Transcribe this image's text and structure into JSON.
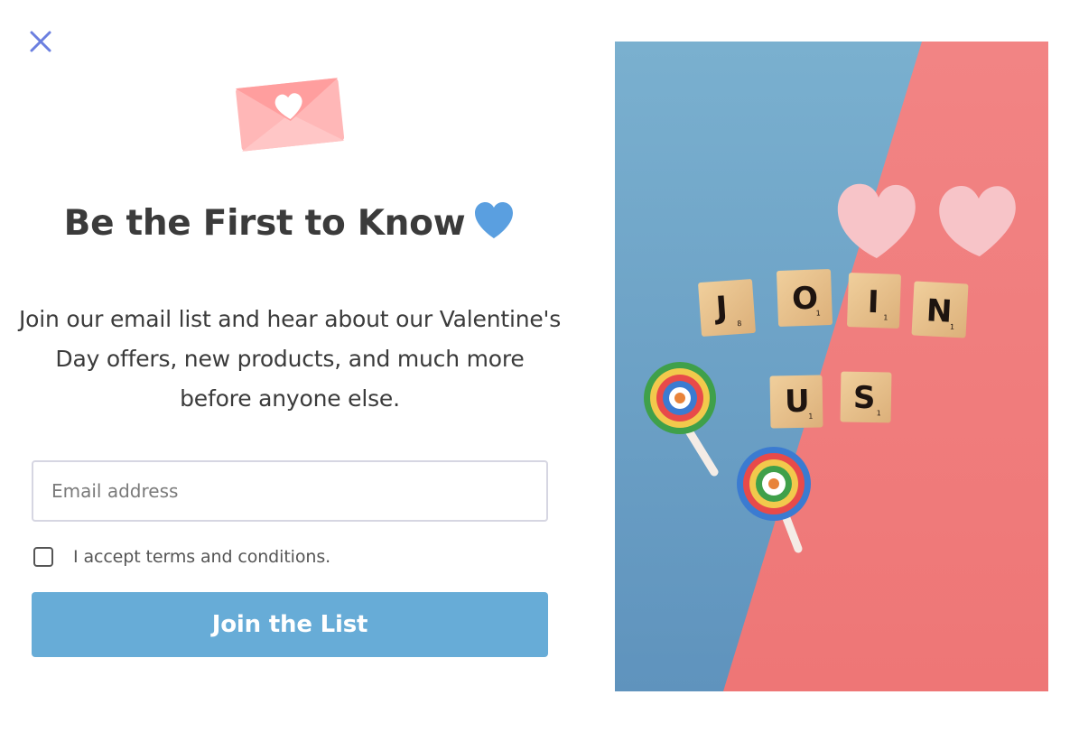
{
  "popup": {
    "title": "Be the First to Know",
    "description": "Join our email list and hear about our Valentine's Day offers, new products, and much more before anyone else.",
    "email_placeholder": "Email address",
    "terms_label": "I accept terms and conditions.",
    "terms_checked": false,
    "submit_label": "Join the List"
  },
  "hero_image": {
    "tiles_row1": [
      {
        "letter": "J",
        "value": "8"
      },
      {
        "letter": "O",
        "value": "1"
      },
      {
        "letter": "I",
        "value": "1"
      },
      {
        "letter": "N",
        "value": "1"
      }
    ],
    "tiles_row2": [
      {
        "letter": "U",
        "value": "1"
      },
      {
        "letter": "S",
        "value": "1"
      }
    ]
  },
  "icons": {
    "close": "close-icon",
    "envelope": "envelope-heart-icon",
    "heart": "blue-heart-icon"
  },
  "colors": {
    "close_icon": "#6b7fe0",
    "title_text": "#3b3b3b",
    "button_bg": "#67acd7",
    "button_text": "#ffffff",
    "heart_blue": "#5a9fe0",
    "envelope_pink": "#ffb3b3",
    "input_border": "#d6d6e2",
    "photo_blue": "#6a9fc4",
    "photo_pink": "#f07c7c"
  }
}
